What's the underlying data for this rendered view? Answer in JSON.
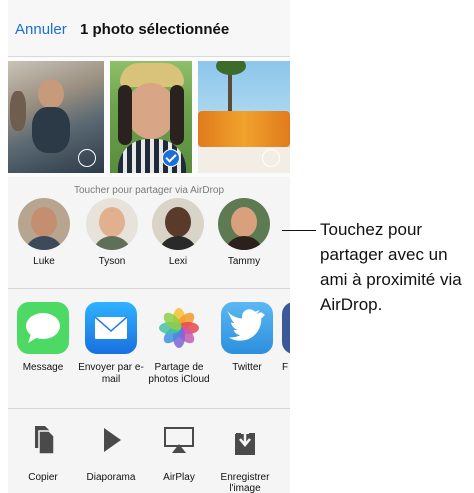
{
  "header": {
    "cancel_label": "Annuler",
    "title": "1 photo sélectionnée"
  },
  "airdrop": {
    "hint": "Toucher pour partager via AirDrop",
    "people": [
      {
        "name": "Luke"
      },
      {
        "name": "Tyson"
      },
      {
        "name": "Lexi"
      },
      {
        "name": "Tammy"
      }
    ]
  },
  "share_apps": [
    {
      "label": "Message",
      "icon": "message-icon",
      "color": "#4cd964"
    },
    {
      "label": "Envoyer par e-mail",
      "icon": "mail-icon",
      "color": "#2f8ff0"
    },
    {
      "label": "Partage de photos iCloud",
      "icon": "photos-icon",
      "color": "#ffffff"
    },
    {
      "label": "Twitter",
      "icon": "twitter-icon",
      "color": "#3b9ee8"
    },
    {
      "label": "F",
      "icon": "more-app-icon",
      "color": "#3b5998"
    }
  ],
  "actions": [
    {
      "label": "Copier",
      "icon": "copy-icon"
    },
    {
      "label": "Diaporama",
      "icon": "slideshow-icon"
    },
    {
      "label": "AirPlay",
      "icon": "airplay-icon"
    },
    {
      "label": "Enregistrer l'image",
      "icon": "save-image-icon"
    }
  ],
  "photos": [
    {
      "selected": false
    },
    {
      "selected": true
    },
    {
      "selected": false
    }
  ],
  "callout": {
    "text": "Touchez pour partager avec un ami à proximité via AirDrop."
  },
  "colors": {
    "accent": "#1a6fd8"
  }
}
